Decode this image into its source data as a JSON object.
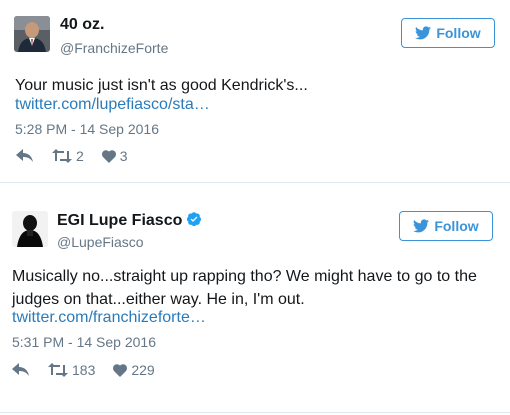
{
  "tweets": [
    {
      "display_name": "40 oz.",
      "handle": "@FranchizeForte",
      "follow_label": "Follow",
      "text": "Your music just isn't as good Kendrick's...",
      "link": "twitter.com/lupefiasco/sta…",
      "timestamp": "5:28 PM - 14 Sep 2016",
      "retweets": "2",
      "likes": "3",
      "verified": false
    },
    {
      "display_name": "EGI Lupe Fiasco",
      "handle": "@LupeFiasco",
      "follow_label": "Follow",
      "text": "Musically no...straight up rapping tho? We might have to go to the judges on that...either way. He in, I'm out.",
      "link": "twitter.com/franchizeforte…",
      "timestamp": "5:31 PM - 14 Sep 2016",
      "retweets": "183",
      "likes": "229",
      "verified": true
    }
  ],
  "icons": {
    "reply": "reply-icon",
    "retweet": "retweet-icon",
    "like": "heart-icon",
    "follow": "twitter-bird-icon",
    "verified": "verified-badge-icon"
  },
  "colors": {
    "link": "#2b7bb9",
    "follow_border": "#3b94d9",
    "muted": "#657786",
    "text": "#14171a",
    "divider": "#e1e8ed"
  }
}
